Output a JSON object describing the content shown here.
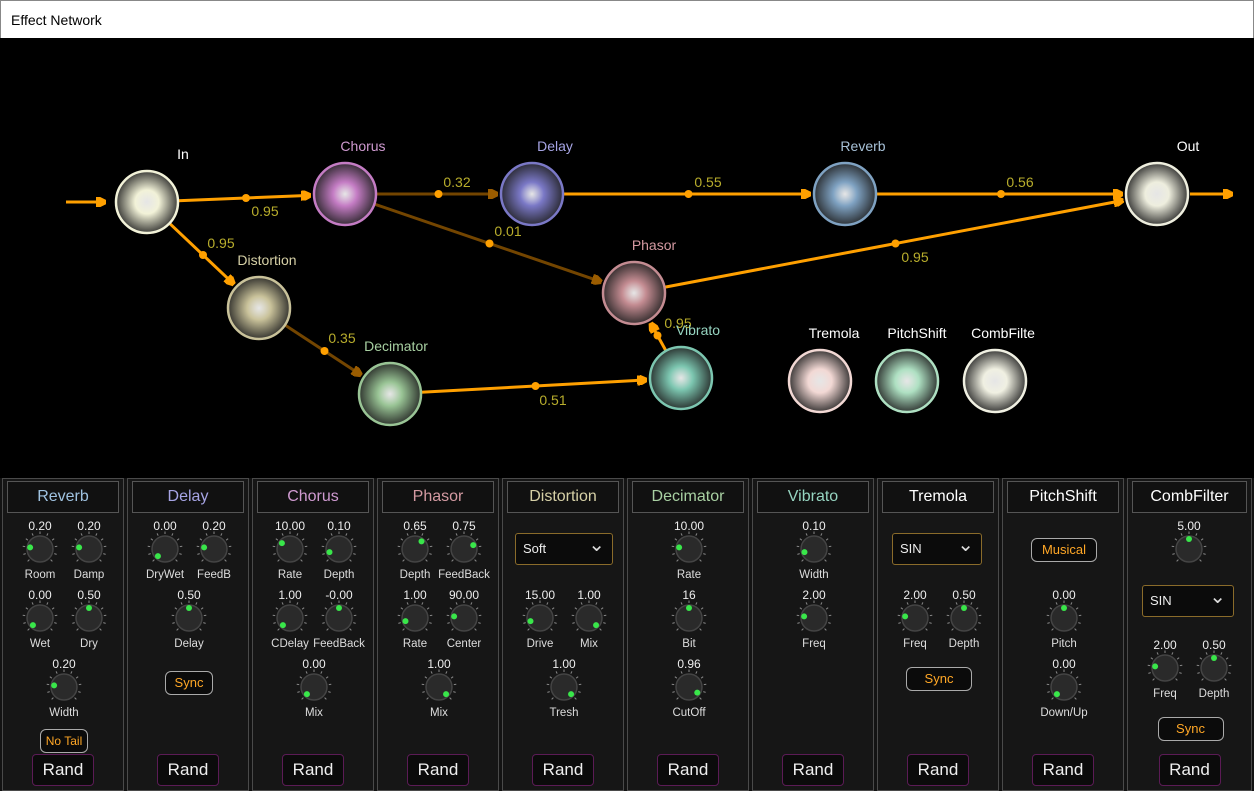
{
  "window": {
    "title": "Effect Network"
  },
  "graph": {
    "nodes": [
      {
        "id": "in",
        "label": "In",
        "color": "#f2f2d8",
        "label_color": "#ffffff"
      },
      {
        "id": "chorus",
        "label": "Chorus",
        "color": "#c47cc4",
        "label_color": "#cf9ad0"
      },
      {
        "id": "delay",
        "label": "Delay",
        "color": "#7a78c6",
        "label_color": "#a6a4e4"
      },
      {
        "id": "reverb",
        "label": "Reverb",
        "color": "#7fa2c2",
        "label_color": "#a8c2d8"
      },
      {
        "id": "out",
        "label": "Out",
        "color": "#eeeede",
        "label_color": "#ffffff"
      },
      {
        "id": "distortion",
        "label": "Distortion",
        "color": "#c9c29a",
        "label_color": "#d6d0a6"
      },
      {
        "id": "phasor",
        "label": "Phasor",
        "color": "#c48c92",
        "label_color": "#d49aa2"
      },
      {
        "id": "decimator",
        "label": "Decimator",
        "color": "#99c495",
        "label_color": "#a8d0a2"
      },
      {
        "id": "vibrato",
        "label": "Vibrato",
        "color": "#7cc6b0",
        "label_color": "#96d4c0"
      },
      {
        "id": "tremola",
        "label": "Tremola",
        "color": "#f2d8d4",
        "label_color": "#ffffff"
      },
      {
        "id": "pitchshift",
        "label": "PitchShift",
        "color": "#aee0c2",
        "label_color": "#ffffff"
      },
      {
        "id": "combfilter",
        "label": "CombFilte",
        "color": "#f0f0e2",
        "label_color": "#ffffff"
      }
    ],
    "edges": [
      {
        "from": "in",
        "to": "chorus",
        "weight": "0.95"
      },
      {
        "from": "in",
        "to": "distortion",
        "weight": "0.95"
      },
      {
        "from": "chorus",
        "to": "delay",
        "weight": "0.32"
      },
      {
        "from": "chorus",
        "to": "phasor",
        "weight": "0.01"
      },
      {
        "from": "delay",
        "to": "reverb",
        "weight": "0.55"
      },
      {
        "from": "reverb",
        "to": "out",
        "weight": "0.56"
      },
      {
        "from": "phasor",
        "to": "out",
        "weight": "0.95"
      },
      {
        "from": "distortion",
        "to": "decimator",
        "weight": "0.35"
      },
      {
        "from": "decimator",
        "to": "vibrato",
        "weight": "0.51"
      },
      {
        "from": "vibrato",
        "to": "phasor",
        "weight": "0.95"
      }
    ],
    "edge_color": "#ffa000"
  },
  "panels": [
    {
      "title": "Reverb",
      "title_color": "#9fc2e0",
      "knobs": [
        {
          "label": "Room",
          "value": "0.20",
          "level": 0.2
        },
        {
          "label": "Damp",
          "value": "0.20",
          "level": 0.2
        },
        {
          "label": "Wet",
          "value": "0.00",
          "level": 0.0
        },
        {
          "label": "Dry",
          "value": "0.50",
          "level": 0.5
        },
        {
          "label": "Width",
          "value": "0.20",
          "level": 0.2
        }
      ],
      "pill": "No Tail",
      "rand": "Rand"
    },
    {
      "title": "Delay",
      "title_color": "#a6a4e4",
      "knobs": [
        {
          "label": "DryWet",
          "value": "0.00",
          "level": 0.0
        },
        {
          "label": "FeedB",
          "value": "0.20",
          "level": 0.2
        },
        {
          "label": "Delay",
          "value": "0.50",
          "level": 0.5
        }
      ],
      "pill": "Sync",
      "rand": "Rand"
    },
    {
      "title": "Chorus",
      "title_color": "#cf9ad0",
      "knobs": [
        {
          "label": "Rate",
          "value": "10.00",
          "level": 0.3
        },
        {
          "label": "Depth",
          "value": "0.10",
          "level": 0.1
        },
        {
          "label": "CDelay",
          "value": "1.00",
          "level": 0.0
        },
        {
          "label": "FeedBack",
          "value": "-0.00",
          "level": 0.5
        },
        {
          "label": "Mix",
          "value": "0.00",
          "level": 0.0
        }
      ],
      "rand": "Rand"
    },
    {
      "title": "Phasor",
      "title_color": "#d49aa2",
      "knobs": [
        {
          "label": "Depth",
          "value": "0.65",
          "level": 0.65
        },
        {
          "label": "FeedBack",
          "value": "0.75",
          "level": 0.75
        },
        {
          "label": "Rate",
          "value": "1.00",
          "level": 0.1
        },
        {
          "label": "Center",
          "value": "90.00",
          "level": 0.2
        },
        {
          "label": "Mix",
          "value": "1.00",
          "level": 1.0
        }
      ],
      "rand": "Rand"
    },
    {
      "title": "Distortion",
      "title_color": "#d6d0a6",
      "select": "Soft",
      "knobs": [
        {
          "label": "Drive",
          "value": "15.00",
          "level": 0.1
        },
        {
          "label": "Mix",
          "value": "1.00",
          "level": 1.0
        },
        {
          "label": "Tresh",
          "value": "1.00",
          "level": 1.0
        }
      ],
      "rand": "Rand"
    },
    {
      "title": "Decimator",
      "title_color": "#a8d0a2",
      "knobs": [
        {
          "label": "Rate",
          "value": "10.00",
          "level": 0.2
        },
        {
          "label": "Bit",
          "value": "16",
          "level": 0.5
        },
        {
          "label": "CutOff",
          "value": "0.96",
          "level": 0.96
        }
      ],
      "rand": "Rand"
    },
    {
      "title": "Vibrato",
      "title_color": "#96d4c0",
      "knobs": [
        {
          "label": "Width",
          "value": "0.10",
          "level": 0.1
        },
        {
          "label": "Freq",
          "value": "2.00",
          "level": 0.2
        }
      ],
      "rand": "Rand"
    },
    {
      "title": "Tremola",
      "title_color": "#ffffff",
      "select": "SIN",
      "knobs": [
        {
          "label": "Freq",
          "value": "2.00",
          "level": 0.2
        },
        {
          "label": "Depth",
          "value": "0.50",
          "level": 0.5
        }
      ],
      "pill": "Sync",
      "rand": "Rand"
    },
    {
      "title": "PitchShift",
      "title_color": "#ffffff",
      "pill_top": "Musical",
      "knobs": [
        {
          "label": "Pitch",
          "value": "0.00",
          "level": 0.5
        },
        {
          "label": "Down/Up",
          "value": "0.00",
          "level": 0.0
        }
      ],
      "rand": "Rand"
    },
    {
      "title": "CombFilter",
      "title_color": "#ffffff",
      "select": "SIN",
      "knobs": [
        {
          "label": "",
          "value": "5.00",
          "level": 0.5
        },
        {
          "label": "Freq",
          "value": "2.00",
          "level": 0.2
        },
        {
          "label": "Depth",
          "value": "0.50",
          "level": 0.5
        }
      ],
      "pill": "Sync",
      "rand": "Rand"
    }
  ]
}
